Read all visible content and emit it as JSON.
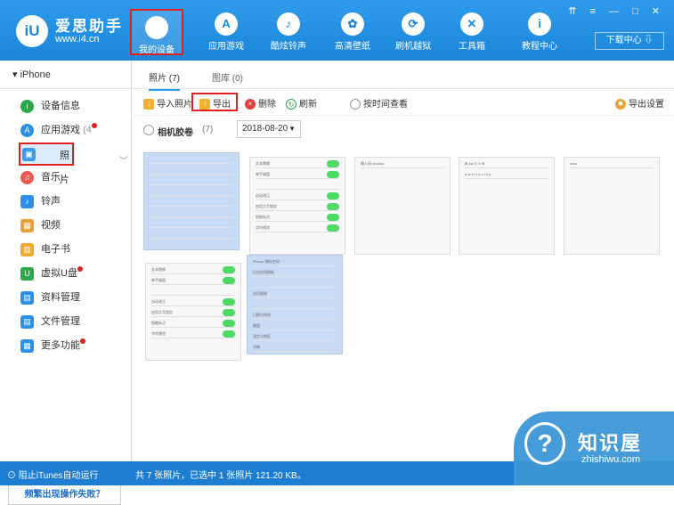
{
  "brand": {
    "title": "爱思助手",
    "url": "www.i4.cn",
    "logo_text": "iU"
  },
  "nav": [
    {
      "label": "我的设备",
      "icon": "apple-icon",
      "glyph": ""
    },
    {
      "label": "应用游戏",
      "icon": "app-store-icon",
      "glyph": "A"
    },
    {
      "label": "酷炫铃声",
      "icon": "bell-icon",
      "glyph": "♪"
    },
    {
      "label": "高清壁纸",
      "icon": "wallpaper-icon",
      "glyph": "✿"
    },
    {
      "label": "刷机越狱",
      "icon": "jailbreak-icon",
      "glyph": "⟳"
    },
    {
      "label": "工具箱",
      "icon": "toolbox-icon",
      "glyph": "✕"
    },
    {
      "label": "教程中心",
      "icon": "tutorial-icon",
      "glyph": "i"
    }
  ],
  "window_controls": "⇈ ≡ — □ ✕",
  "download_center": "下载中心 ⇩",
  "device": "iPhone",
  "sidebar": [
    {
      "label": "设备信息",
      "color": "#2aa84a",
      "glyph": "i"
    },
    {
      "label": "应用游戏",
      "count": "(4",
      "color": "#2d8fe6",
      "glyph": "A",
      "badge": true
    },
    {
      "label": "照片",
      "color": "#3b9be6",
      "glyph": "▣",
      "selected": true
    },
    {
      "label": "音乐",
      "color": "#e85a4f",
      "glyph": "♫"
    },
    {
      "label": "铃声",
      "color": "#2d8fe6",
      "glyph": "♪"
    },
    {
      "label": "视频",
      "color": "#e8a13a",
      "glyph": "▦"
    },
    {
      "label": "电子书",
      "color": "#f0a830",
      "glyph": "▥"
    },
    {
      "label": "虚拟U盘",
      "color": "#2aa84a",
      "glyph": "U",
      "badge": true
    },
    {
      "label": "资料管理",
      "color": "#2d8fe6",
      "glyph": "▤"
    },
    {
      "label": "文件管理",
      "color": "#2d8fe6",
      "glyph": "▤"
    },
    {
      "label": "更多功能",
      "color": "#2d8fe6",
      "glyph": "▦",
      "badge": true
    }
  ],
  "fail_button": "频繁出现操作失败？",
  "tabs": {
    "photos": "照片 (7)",
    "gallery": "图库 (0)"
  },
  "toolbar": {
    "import": "导入照片",
    "export": "导出",
    "delete": "删除",
    "refresh": "刷新",
    "time_view": "按时间查看",
    "export_settings": "导出设置"
  },
  "filter": {
    "label": "相机胶卷",
    "count": "(7)",
    "date": "2018-08-20"
  },
  "photo_rows": [
    [
      "",
      "",
      "",
      "",
      "",
      "",
      "",
      ""
    ],
    [
      "文本替换",
      "单手键盘",
      "",
      "自动改正",
      "启用大写锁定",
      "智能标点",
      "字符预览"
    ],
    [
      "输入码   mhuiso"
    ],
    [
      "⊞  Aa  ⊙  ⊙  ⊗",
      "q w e r t y u i o p"
    ],
    [
      "mad"
    ],
    [
      "文本替换",
      "单手键盘",
      "",
      "自动改正",
      "启用大写锁定",
      "智能标点",
      "字符预览"
    ],
    [
      "iPhone 储存空间",
      "后台应用刷新",
      "",
      "访问限制",
      "",
      "日期与时间",
      "键盘",
      "语言与地区",
      "词典"
    ]
  ],
  "status": {
    "itunes": "阻止iTunes自动运行",
    "summary": "共 7 张照片，已选中 1 张照片 121.20 KB。"
  },
  "watermark": {
    "title": "知识屋",
    "url": "zhishiwu.com",
    "glyph": "?"
  }
}
